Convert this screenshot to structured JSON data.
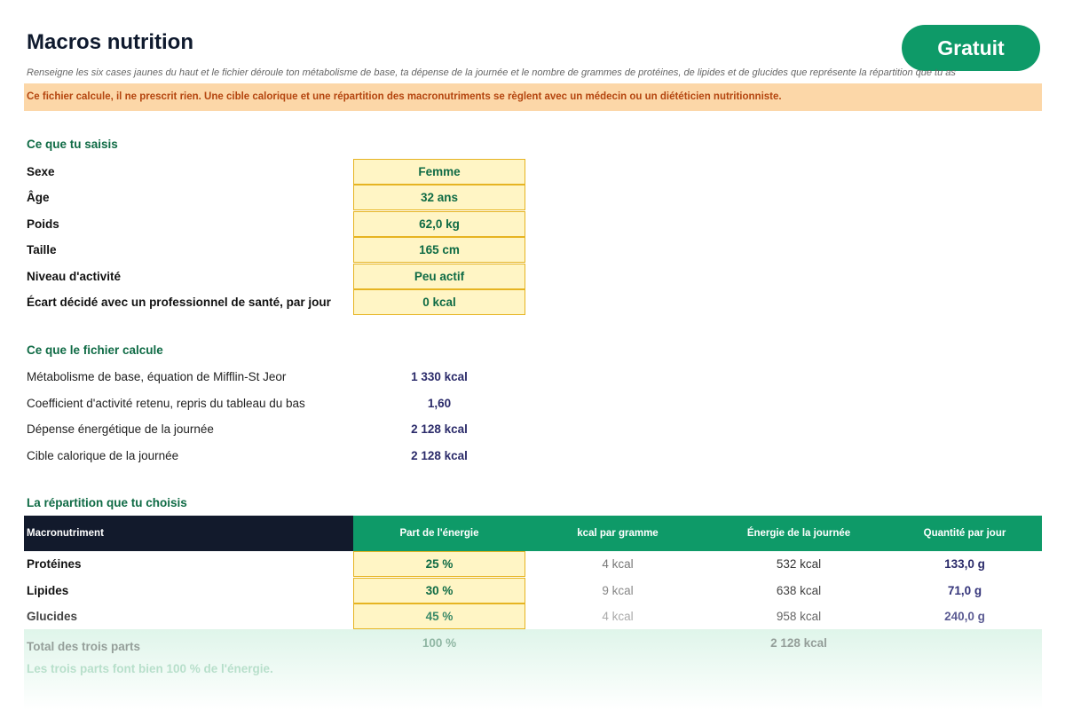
{
  "header": {
    "title": "Macros nutrition",
    "badge": "Gratuit",
    "subtitle": "Renseigne les six cases jaunes du haut et le fichier déroule ton métabolisme de base, ta dépense de la journée et le nombre de grammes de protéines, de lipides et de glucides que représente la répartition que tu as",
    "warning": "Ce fichier calcule, il ne prescrit rien. Une cible calorique et une répartition des macronutriments se règlent avec un médecin ou un diététicien nutritionniste."
  },
  "inputs": {
    "heading": "Ce que tu saisis",
    "rows": [
      {
        "label": "Sexe",
        "value": "Femme"
      },
      {
        "label": "Âge",
        "value": "32 ans"
      },
      {
        "label": "Poids",
        "value": "62,0 kg"
      },
      {
        "label": "Taille",
        "value": "165 cm"
      },
      {
        "label": "Niveau d'activité",
        "value": "Peu actif"
      },
      {
        "label": "Écart décidé avec un professionnel de santé, par jour",
        "value": "0 kcal"
      }
    ]
  },
  "results": {
    "heading": "Ce que le fichier calcule",
    "rows": [
      {
        "label": "Métabolisme de base, équation de Mifflin-St Jeor",
        "value": "1 330 kcal"
      },
      {
        "label": "Coefficient d'activité retenu, repris du tableau du bas",
        "value": "1,60"
      },
      {
        "label": "Dépense énergétique de la journée",
        "value": "2 128 kcal"
      },
      {
        "label": "Cible calorique de la journée",
        "value": "2 128 kcal"
      }
    ]
  },
  "split": {
    "heading": "La répartition que tu choisis",
    "columns": [
      "Macronutriment",
      "Part de l'énergie",
      "kcal par gramme",
      "Énergie de la journée",
      "Quantité par jour"
    ],
    "rows": [
      {
        "name": "Protéines",
        "part": "25 %",
        "kcal_per_g": "4 kcal",
        "energy": "532 kcal",
        "qty": "133,0 g"
      },
      {
        "name": "Lipides",
        "part": "30 %",
        "kcal_per_g": "9 kcal",
        "energy": "638 kcal",
        "qty": "71,0 g"
      },
      {
        "name": "Glucides",
        "part": "45 %",
        "kcal_per_g": "4 kcal",
        "energy": "958 kcal",
        "qty": "240,0 g"
      }
    ],
    "total": {
      "label": "Total des trois parts",
      "part": "100 %",
      "energy": "2 128 kcal"
    },
    "check": "Les trois parts font bien 100 % de l'énergie."
  },
  "colors": {
    "accent": "#0e9a68",
    "input_fill": "#fff5c5",
    "warning_fill": "#fcd7a8",
    "header_dark": "#121a2c"
  }
}
